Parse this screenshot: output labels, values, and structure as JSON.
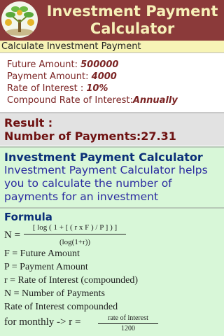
{
  "header": {
    "title": "Investment Payment\nCalculator",
    "logo_icon": "money-tree-icon"
  },
  "subbar": {
    "label": "Calculate Investment Payment"
  },
  "inputs": [
    {
      "label": "Future Amount: ",
      "value": "500000"
    },
    {
      "label": "Payment Amount: ",
      "value": "4000"
    },
    {
      "label": "Rate of Interest : ",
      "value": "10%"
    },
    {
      "label": "Compound Rate of Interest:",
      "value": "Annually"
    }
  ],
  "result": {
    "heading": "Result :",
    "line": "Number of Payments:27.31"
  },
  "info": {
    "title": "Investment Payment Calculator",
    "description": "Investment Payment Calculator helps you to calculate the number of payments for an investment"
  },
  "formula": {
    "title": "Formula",
    "n_eq": "N =",
    "numerator": "[ log ( 1 + [ ( r x F ) / P ] ) ]",
    "denominator": "(log(1+r))",
    "definitions": [
      "F = Future Amount",
      "P = Payment Amount",
      "r = Rate of Interest (compounded)",
      "N = Number of Payments",
      "Rate of Interest compounded"
    ],
    "monthly_prefix": "for monthly -> r =",
    "monthly_numerator": "rate of interest",
    "monthly_denominator": "1200"
  },
  "colors": {
    "header_bg": "#8b3a3a",
    "title_text": "#f6f0b8",
    "subbar_bg": "#f7f4b6",
    "input_text": "#7b2424",
    "result_bg": "#e2e2e2",
    "info_bg": "#d8f7d8",
    "info_title": "#0a2f78",
    "info_text": "#2a2aa0"
  }
}
